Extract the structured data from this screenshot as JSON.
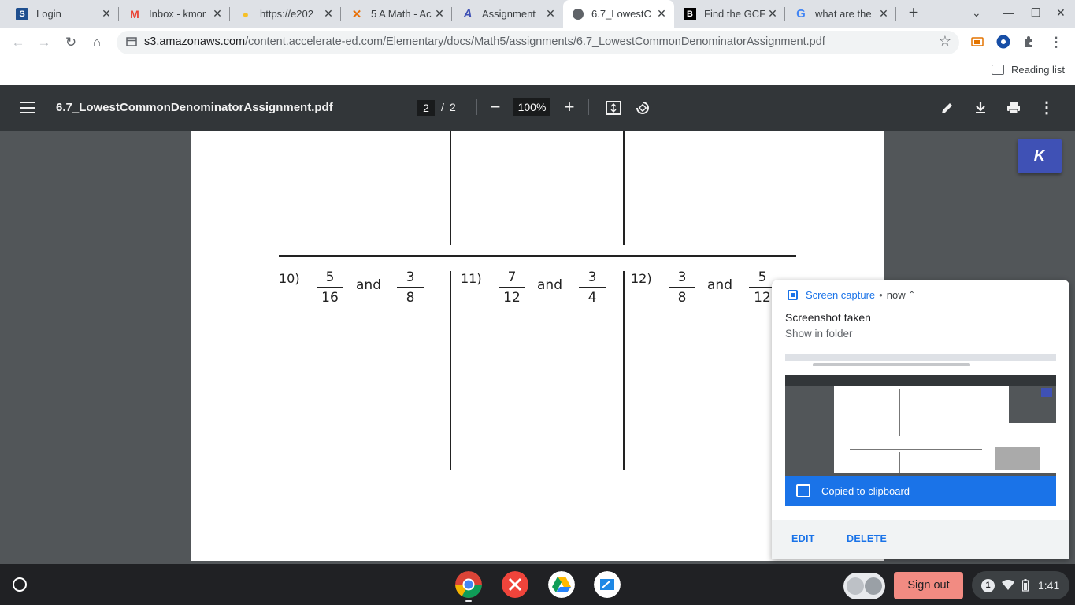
{
  "browser": {
    "tabs": [
      {
        "title": "Login",
        "favicon": "schoology-icon",
        "active": false
      },
      {
        "title": "Inbox - kmor",
        "favicon": "gmail-icon",
        "active": false
      },
      {
        "title": "https://e202",
        "favicon": "lightbulb-icon",
        "active": false
      },
      {
        "title": "5 A Math - Ac",
        "favicon": "x-logo-icon",
        "active": false
      },
      {
        "title": "Assignment",
        "favicon": "accelerate-icon",
        "active": false
      },
      {
        "title": "6.7_LowestC",
        "favicon": "globe-icon",
        "active": true
      },
      {
        "title": "Find the GCF",
        "favicon": "b-logo-icon",
        "active": false
      },
      {
        "title": "what are the",
        "favicon": "google-icon",
        "active": false
      }
    ],
    "address": {
      "host": "s3.amazonaws.com",
      "path": "/content.accelerate-ed.com/Elementary/docs/Math5/assignments/6.7_LowestCommonDenominatorAssignment.pdf"
    },
    "reading_list_label": "Reading list"
  },
  "pdf_viewer": {
    "filename": "6.7_LowestCommonDenominatorAssignment.pdf",
    "current_page": "2",
    "page_separator": "/",
    "total_pages": "2",
    "zoom": "100%"
  },
  "worksheet": {
    "problems": [
      {
        "number": "10)",
        "a": {
          "num": "5",
          "den": "16"
        },
        "word": "and",
        "b": {
          "num": "3",
          "den": "8"
        }
      },
      {
        "number": "11)",
        "a": {
          "num": "7",
          "den": "12"
        },
        "word": "and",
        "b": {
          "num": "3",
          "den": "4"
        }
      },
      {
        "number": "12)",
        "a": {
          "num": "3",
          "den": "8"
        },
        "word": "and",
        "b": {
          "num": "5",
          "den": "12"
        }
      }
    ]
  },
  "floating_button": {
    "label": "K"
  },
  "notification": {
    "app": "Screen capture",
    "separator": "•",
    "time": "now",
    "title": "Screenshot taken",
    "subtitle": "Show in folder",
    "clipboard_text": "Copied to clipboard",
    "actions": [
      "EDIT",
      "DELETE"
    ]
  },
  "shelf": {
    "apps": [
      "chrome-icon",
      "anydesk-icon",
      "google-drive-icon",
      "whiteboard-icon"
    ],
    "sign_out_label": "Sign out",
    "notification_count": "1",
    "time": "1:41"
  }
}
